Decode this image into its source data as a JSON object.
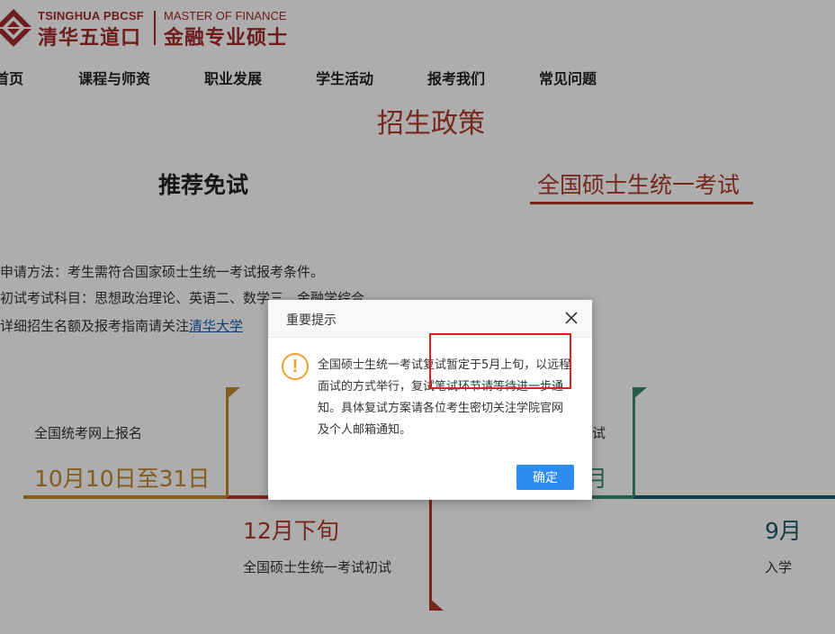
{
  "header": {
    "logo_en_left": "TSINGHUA PBCSF",
    "logo_cn_left": "清华五道口",
    "logo_en_right": "MASTER OF FINANCE",
    "logo_cn_right": "金融专业硕士"
  },
  "nav": {
    "items": [
      {
        "label": "首页"
      },
      {
        "label": "课程与师资"
      },
      {
        "label": "职业发展"
      },
      {
        "label": "学生活动"
      },
      {
        "label": "报考我们"
      },
      {
        "label": "常见问题"
      }
    ]
  },
  "main": {
    "title": "招生政策",
    "tabs": [
      {
        "label": "推荐免试",
        "active": false
      },
      {
        "label": "全国硕士生统一考试",
        "active": true
      }
    ],
    "info": {
      "line1": "申请方法：考生需符合国家硕士生统一考试报考条件。",
      "line2": "初试考试科目：思想政治理论、英语二、数学三、金融学综合",
      "line3_prefix": "详细招生名额及报考指南请关注",
      "line3_link": "清华大学"
    }
  },
  "timeline": {
    "items": [
      {
        "date": "10月10日至31日",
        "text": "全国统考网上报名",
        "color": "#c08a2e"
      },
      {
        "date": "12月下旬",
        "text": "全国硕士生统一考试初试",
        "color": "#b23a2a"
      },
      {
        "date": "…",
        "text": "试",
        "partial_date": "月",
        "color": "#3a8a6f"
      },
      {
        "date": "9月",
        "text": "入学",
        "color": "#1d5a6a"
      }
    ]
  },
  "modal": {
    "title": "重要提示",
    "message": "全国硕士生统一考试复试暂定于5月上旬，以远程面试的方式举行，复试笔试环节请等待进一步通知。具体复试方案请各位考生密切关注学院官网及个人邮箱通知。",
    "ok_label": "确定",
    "icon": "warning-icon",
    "close_icon": "close-icon"
  },
  "colors": {
    "brand_red": "#a12c2c",
    "accent": "#b23a2a",
    "button_blue": "#2d8cf0",
    "warning": "#f0a030",
    "annotation_red": "#e0201e"
  }
}
